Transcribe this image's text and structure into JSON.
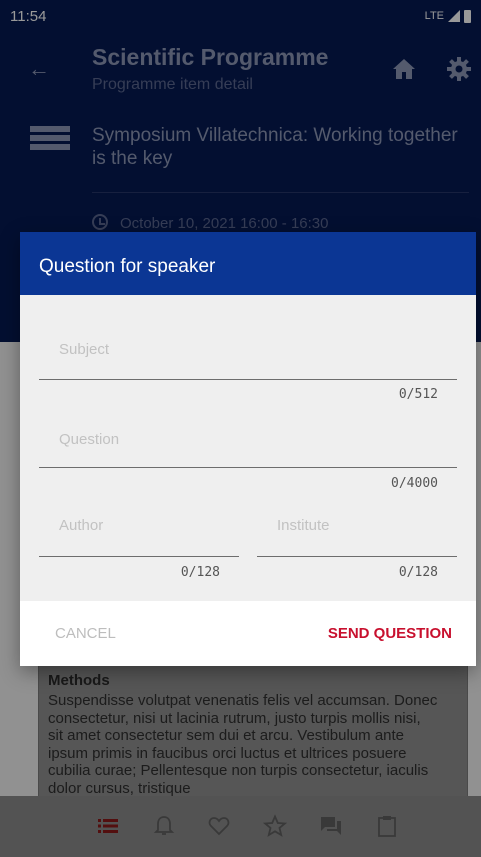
{
  "status_bar": {
    "time": "11:54",
    "network": "LTE"
  },
  "app_bar": {
    "title": "Scientific Programme",
    "subtitle": "Programme item detail",
    "icons": [
      "back-arrow-icon",
      "home-icon",
      "gear-icon"
    ]
  },
  "session": {
    "title": "Symposium Villatechnica: Working together is the key",
    "time": "October 10, 2021 16:00 - 16:30"
  },
  "content": {
    "heading": "Methods",
    "text": "Suspendisse volutpat venenatis felis vel accumsan. Donec consectetur, nisi ut lacinia rutrum, justo turpis mollis nisi, sit amet consectetur sem dui et arcu. Vestibulum ante ipsum primis in faucibus orci luctus et ultrices posuere cubilia curae; Pellentesque non turpis consectetur, iaculis dolor cursus, tristique"
  },
  "bottom_nav": [
    "list-icon",
    "bell-icon",
    "heart-icon",
    "star-icon",
    "chat-icon",
    "clipboard-icon"
  ],
  "dialog": {
    "title": "Question for speaker",
    "subject": {
      "placeholder": "Subject",
      "value": "",
      "counter": "0/512"
    },
    "question": {
      "placeholder": "Question",
      "value": "",
      "counter": "0/4000"
    },
    "author": {
      "placeholder": "Author",
      "value": "",
      "counter": "0/128"
    },
    "institute": {
      "placeholder": "Institute",
      "value": "",
      "counter": "0/128"
    },
    "cancel_label": "CANCEL",
    "send_label": "SEND QUESTION"
  },
  "colors": {
    "header_dark": "#051a52",
    "dialog_header": "#0b3694",
    "accent_red": "#c8102e",
    "nav_active": "#8b1a1a"
  }
}
